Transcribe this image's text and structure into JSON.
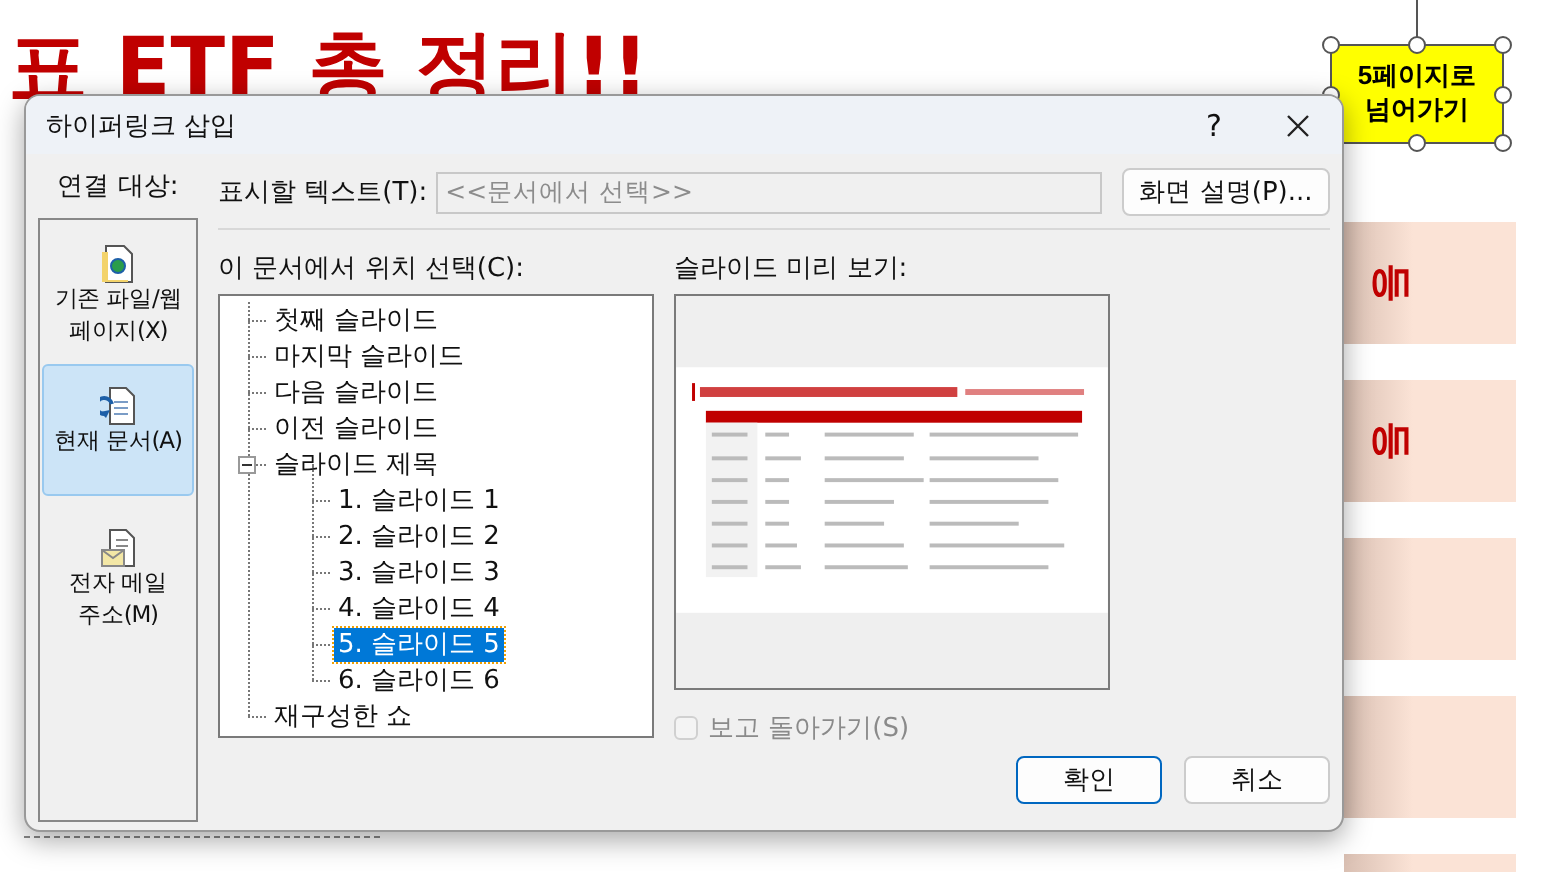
{
  "backdrop": {
    "title": "표 ETF 총 정리!!",
    "shape_label": "5페이지로 넘어가기",
    "band_labels": [
      "등",
      "등"
    ]
  },
  "dialog": {
    "title": "하이퍼링크 삽입",
    "help": "?",
    "link_to_label": "연결 대상:",
    "link_types": [
      {
        "kind": "file",
        "label": "기존 파일/웹 페이지(X)",
        "selected": false
      },
      {
        "kind": "document",
        "label": "현재 문서(A)",
        "selected": true
      },
      {
        "kind": "email",
        "label": "전자 메일 주소(M)",
        "selected": false
      }
    ],
    "display_text": {
      "label": "표시할 텍스트(T):",
      "value": "<<문서에서 선택>>",
      "disabled": true
    },
    "screentip_button": "화면 설명(P)...",
    "place_label": "이 문서에서 위치 선택(C):",
    "tree": [
      {
        "label": "첫째 슬라이드",
        "selected": false
      },
      {
        "label": "마지막 슬라이드",
        "selected": false
      },
      {
        "label": "다음 슬라이드",
        "selected": false
      },
      {
        "label": "이전 슬라이드",
        "selected": false
      },
      {
        "label": "슬라이드 제목",
        "selected": false,
        "expanded": true,
        "children": [
          {
            "label": "1. 슬라이드 1",
            "selected": false
          },
          {
            "label": "2. 슬라이드 2",
            "selected": false
          },
          {
            "label": "3. 슬라이드 3",
            "selected": false
          },
          {
            "label": "4. 슬라이드 4",
            "selected": false
          },
          {
            "label": "5. 슬라이드 5",
            "selected": true
          },
          {
            "label": "6. 슬라이드 6",
            "selected": false
          }
        ]
      },
      {
        "label": "재구성한 쇼",
        "selected": false
      }
    ],
    "preview_label": "슬라이드 미리 보기:",
    "show_return": {
      "label": "보고 돌아가기(S)",
      "checked": false,
      "disabled": true
    },
    "buttons": [
      {
        "label": "확인",
        "default": true
      },
      {
        "label": "취소",
        "default": false
      }
    ]
  }
}
